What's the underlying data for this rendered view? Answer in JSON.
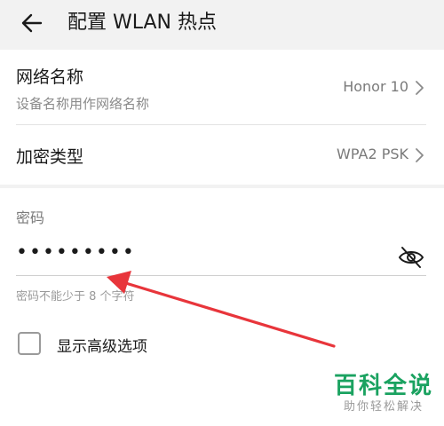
{
  "header": {
    "title": "配置 WLAN 热点",
    "back_icon": "back-arrow-icon"
  },
  "network": {
    "name_label": "网络名称",
    "name_sub": "设备名称用作网络名称",
    "name_value": "Honor 10",
    "security_label": "加密类型",
    "security_value": "WPA2 PSK"
  },
  "password": {
    "label": "密码",
    "value": "•••••••••",
    "hint": "密码不能少于 8 个字符",
    "visibility_icon": "eye-off-icon"
  },
  "advanced": {
    "label": "显示高级选项",
    "checked": false
  },
  "watermark": {
    "title": "百科全说",
    "subtitle": "助你轻松解决"
  },
  "colors": {
    "annotation_arrow": "#e8353b",
    "watermark": "#1aa260"
  }
}
